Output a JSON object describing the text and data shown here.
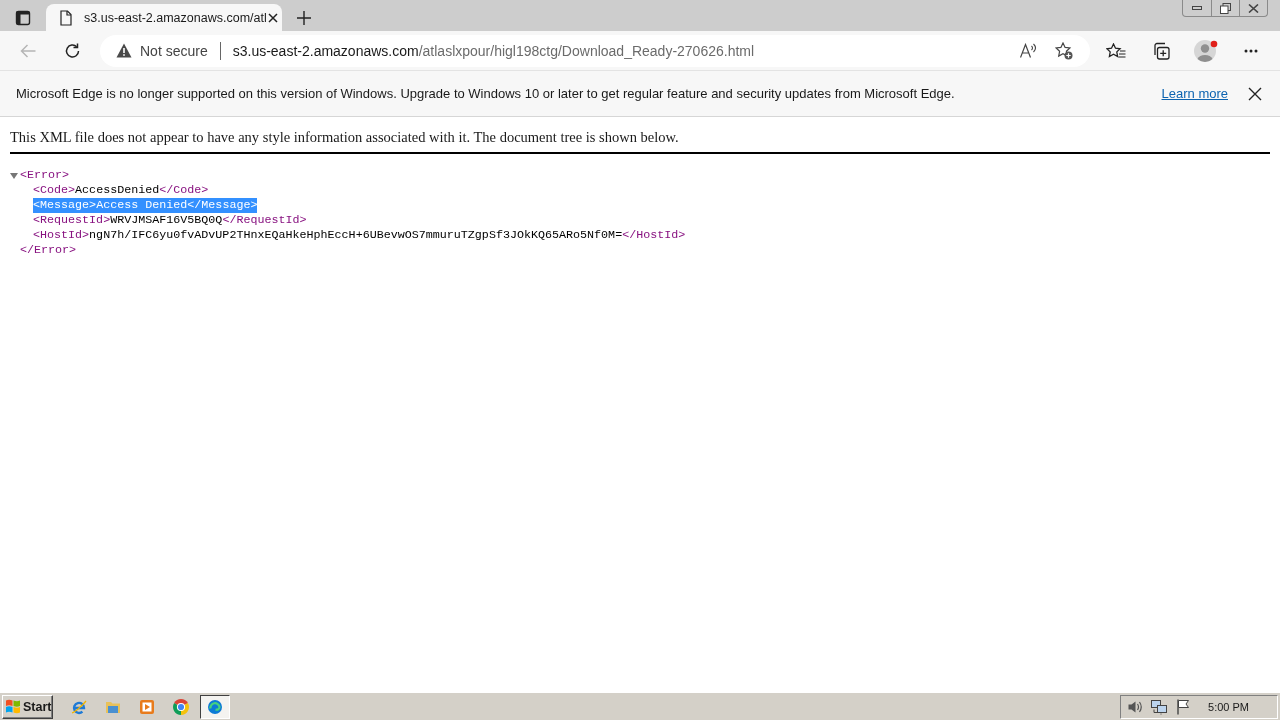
{
  "tab_strip": {
    "tabs": [
      {
        "title": "s3.us-east-2.amazonaws.com/atl",
        "selected": true
      }
    ]
  },
  "toolbar": {
    "back_disabled": true,
    "address": {
      "security": "Not secure",
      "host": "s3.us-east-2.amazonaws.com",
      "path": "/atlaslxpour/higl198ctg/Download_Ready-270626.html"
    }
  },
  "infobar": {
    "message": "Microsoft Edge is no longer supported on this version of Windows. Upgrade to Windows 10 or later to get regular feature and security updates from Microsoft Edge.",
    "link": "Learn more"
  },
  "document": {
    "notice": "This XML file does not appear to have any style information associated with it. The document tree is shown below.",
    "tree": {
      "open": "<Error>",
      "expanded": true,
      "close": "</Error>",
      "children": [
        {
          "open": "<Code>",
          "text": "AccessDenied",
          "close": "</Code>",
          "selected": false
        },
        {
          "open": "<Message>",
          "text": "Access Denied",
          "close": "</Message>",
          "selected": true
        },
        {
          "open": "<RequestId>",
          "text": "WRVJMSAF16V5BQ0Q",
          "close": "</RequestId>",
          "selected": false
        },
        {
          "open": "<HostId>",
          "text": "ngN7h/IFC6yu0fvADvUP2THnxEQaHkeHphEccH+6UBevwOS7mmuruTZgpSf3JOkKQ65ARo5Nf0M=",
          "close": "</HostId>",
          "selected": false
        }
      ]
    }
  },
  "taskbar": {
    "start": "Start",
    "apps": [
      {
        "kind": "ie",
        "selected": false
      },
      {
        "kind": "folder",
        "selected": false
      },
      {
        "kind": "media",
        "selected": false
      },
      {
        "kind": "chrome",
        "selected": false
      },
      {
        "kind": "edge",
        "selected": true
      }
    ],
    "clock": "5:00 PM"
  }
}
